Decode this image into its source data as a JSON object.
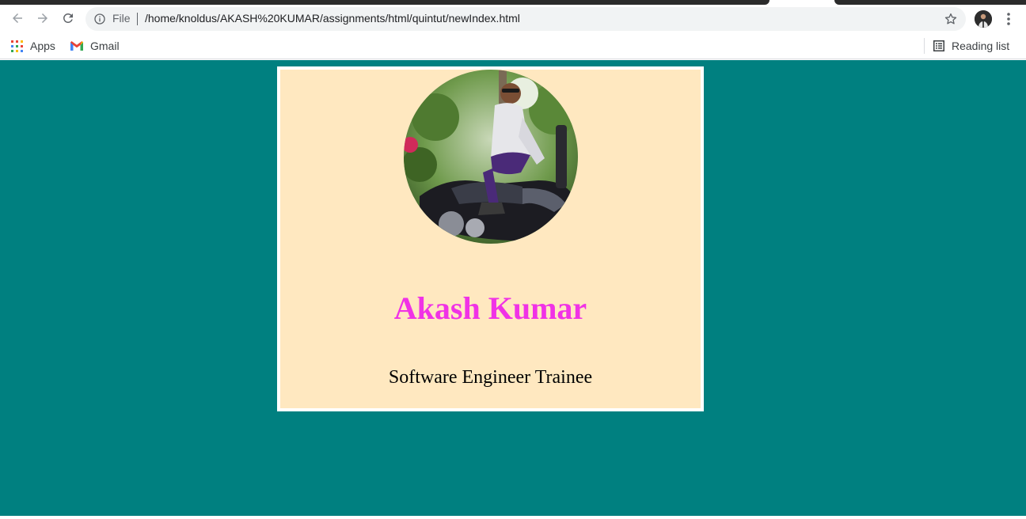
{
  "browser": {
    "scheme_label": "File",
    "url": "/home/knoldus/AKASH%20KUMAR/assignments/html/quintut/newIndex.html",
    "icons": {
      "back": "arrow-left-icon",
      "forward": "arrow-right-icon",
      "reload": "reload-icon",
      "info": "info-icon",
      "bookmark_star": "star-icon",
      "menu": "kebab-menu-icon"
    }
  },
  "bookmarks_bar": {
    "apps_label": "Apps",
    "gmail_label": "Gmail",
    "reading_list_label": "Reading list"
  },
  "profile": {
    "name": "Akash Kumar",
    "title": "Software Engineer Trainee"
  },
  "colors": {
    "page_background": "#008080",
    "card_background": "#ffe8c0",
    "card_border": "#ffffff",
    "name_color": "#f032e6",
    "title_color": "#000000"
  }
}
